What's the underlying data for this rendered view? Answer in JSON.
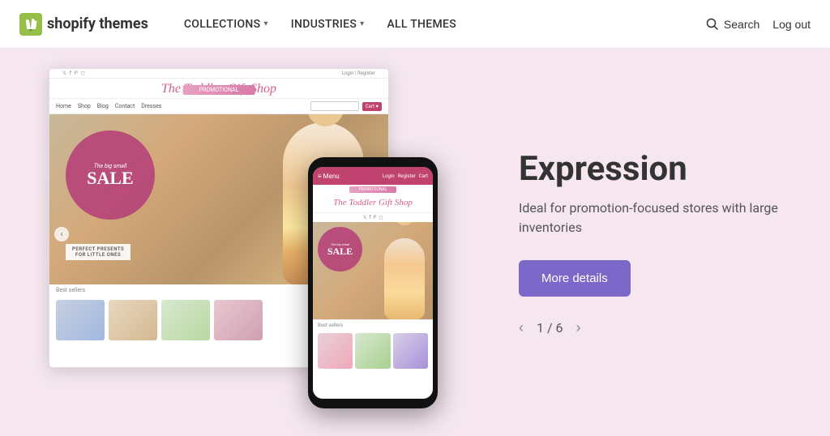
{
  "header": {
    "logo_brand": "shopify",
    "logo_suffix": " themes",
    "nav": [
      {
        "label": "COLLECTIONS",
        "has_dropdown": true
      },
      {
        "label": "INDUSTRIES",
        "has_dropdown": true
      },
      {
        "label": "ALL THEMES",
        "has_dropdown": false
      }
    ],
    "search_label": "Search",
    "logout_label": "Log out"
  },
  "hero": {
    "theme_name": "Expression",
    "theme_desc": "Ideal for promotion-focused stores with large inventories",
    "more_details_label": "More details",
    "pagination": {
      "current": 1,
      "total": 6,
      "separator": "/"
    },
    "store_name": "The Toddler Gift Shop",
    "promo_banner": "PROMOTIONAL",
    "sale_small": "The big small",
    "sale_big": "SALE",
    "best_sellers_label": "Best sellers",
    "nav_links": [
      "Home",
      "Shop",
      "Blog",
      "Contact",
      "Dresses"
    ],
    "login_text": "Login | Register",
    "phone_menu": "≡ Menu",
    "phone_actions": [
      "Login",
      "Register",
      "Cart ♥"
    ]
  }
}
